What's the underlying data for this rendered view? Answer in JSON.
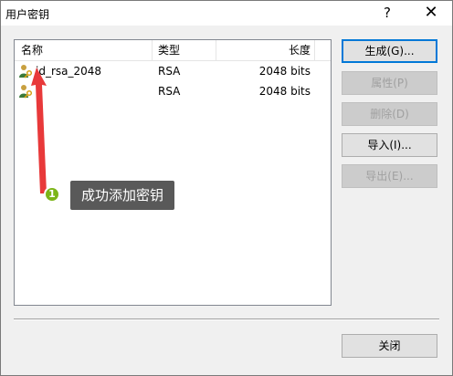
{
  "window": {
    "title": "用户密钥",
    "help_label": "?",
    "close_label": "✕"
  },
  "list": {
    "columns": [
      "名称",
      "类型",
      "长度"
    ],
    "rows": [
      {
        "name": "id_rsa_2048",
        "type": "RSA",
        "length": "2048 bits"
      },
      {
        "name": "",
        "type": "RSA",
        "length": "2048 bits"
      }
    ]
  },
  "buttons": {
    "generate": "生成(G)...",
    "properties": "属性(P)",
    "delete": "删除(D)",
    "import": "导入(I)...",
    "export": "导出(E)...",
    "close": "关闭"
  },
  "annotation": {
    "number": "1",
    "text": "成功添加密钥",
    "color": "#e8393a"
  },
  "icons": {
    "key": "user-key-icon"
  }
}
